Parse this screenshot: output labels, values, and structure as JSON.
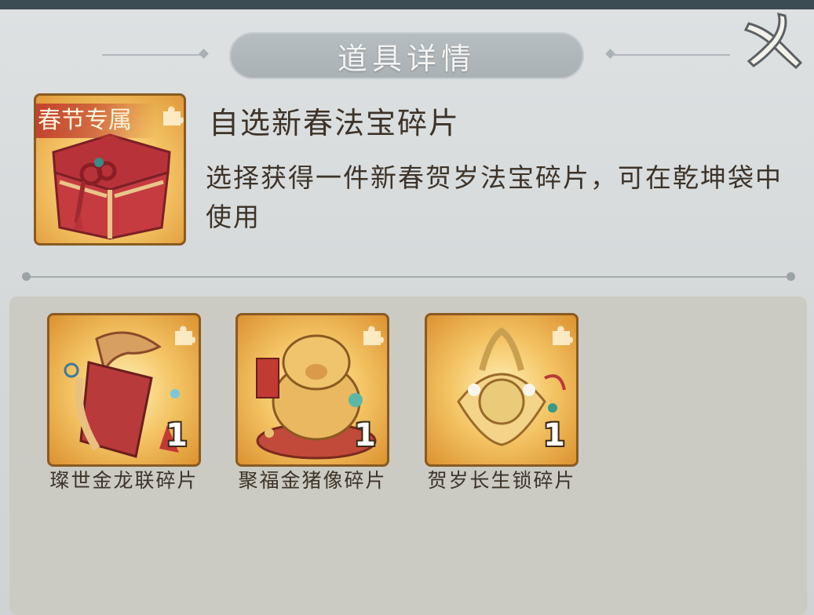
{
  "dialog": {
    "title": "道具详情",
    "close_icon": "close-icon"
  },
  "item": {
    "badge": "春节专属",
    "name": "自选新春法宝碎片",
    "description": "选择获得一件新春贺岁法宝碎片，可在乾坤袋中使用",
    "icon": "red-treasure-chest-icon"
  },
  "rewards": [
    {
      "name": "璨世金龙联碎片",
      "count": "1",
      "icon": "golden-dragon-scroll-icon"
    },
    {
      "name": "聚福金猪像碎片",
      "count": "1",
      "icon": "golden-pig-statue-icon"
    },
    {
      "name": "贺岁长生锁碎片",
      "count": "1",
      "icon": "longevity-lock-icon"
    }
  ],
  "colors": {
    "panel": "#d6dadb",
    "title_pill": "#b0b7bb",
    "text": "#3d3328",
    "frame": "#8a5a22",
    "gold": "#f4c566",
    "badge": "#c13e2e"
  }
}
